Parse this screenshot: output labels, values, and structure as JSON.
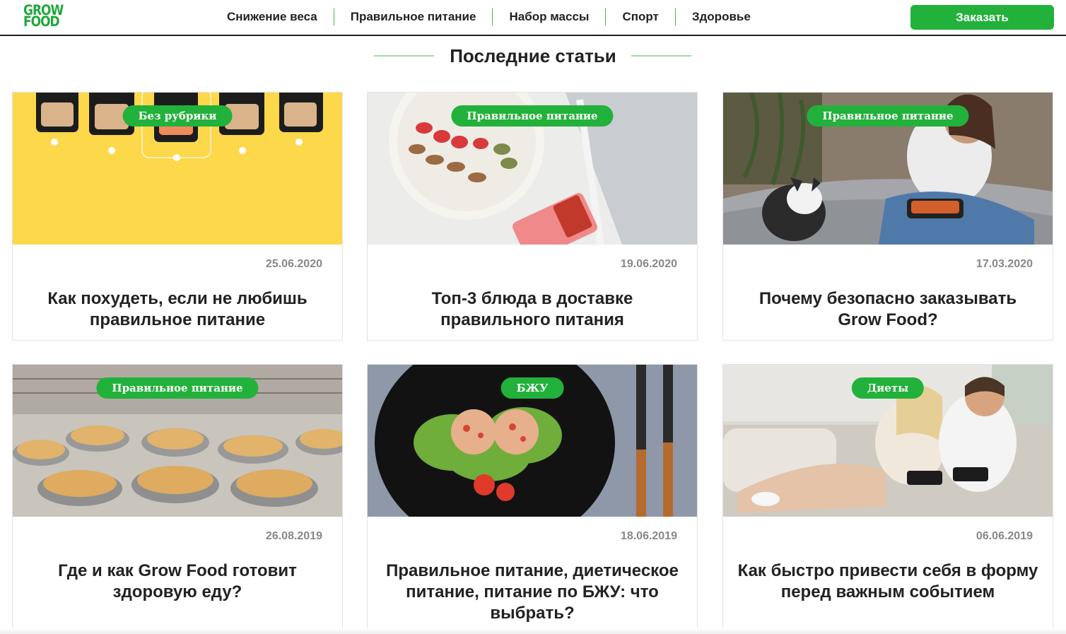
{
  "header": {
    "logo_line1": "GROW",
    "logo_line2": "FOOD",
    "nav": [
      {
        "label": "Снижение веса"
      },
      {
        "label": "Правильное питание"
      },
      {
        "label": "Набор массы"
      },
      {
        "label": "Спорт"
      },
      {
        "label": "Здоровье"
      }
    ],
    "order_label": "Заказать"
  },
  "main": {
    "section_title": "Последние статьи",
    "articles": [
      {
        "category": "Без рубрики",
        "date": "25.06.2020",
        "title": "Как похудеть, если не любишь правильное питание"
      },
      {
        "category": "Правильное питание",
        "date": "19.06.2020",
        "title": "Топ-3 блюда в доставке правильного питания"
      },
      {
        "category": "Правильное питание",
        "date": "17.03.2020",
        "title": "Почему безопасно заказывать Grow Food?"
      },
      {
        "category": "Правильное питание",
        "date": "26.08.2019",
        "title": "Где и как Grow Food готовит здоровую еду?"
      },
      {
        "category": "БЖУ",
        "date": "18.06.2019",
        "title": "Правильное питание, диетическое питание, питание по БЖУ: что выбрать?"
      },
      {
        "category": "Диеты",
        "date": "06.06.2019",
        "title": "Как быстро привести себя в форму перед важным событием"
      }
    ]
  },
  "colors": {
    "accent": "#22b13b",
    "text": "#222222",
    "date": "#888888"
  }
}
